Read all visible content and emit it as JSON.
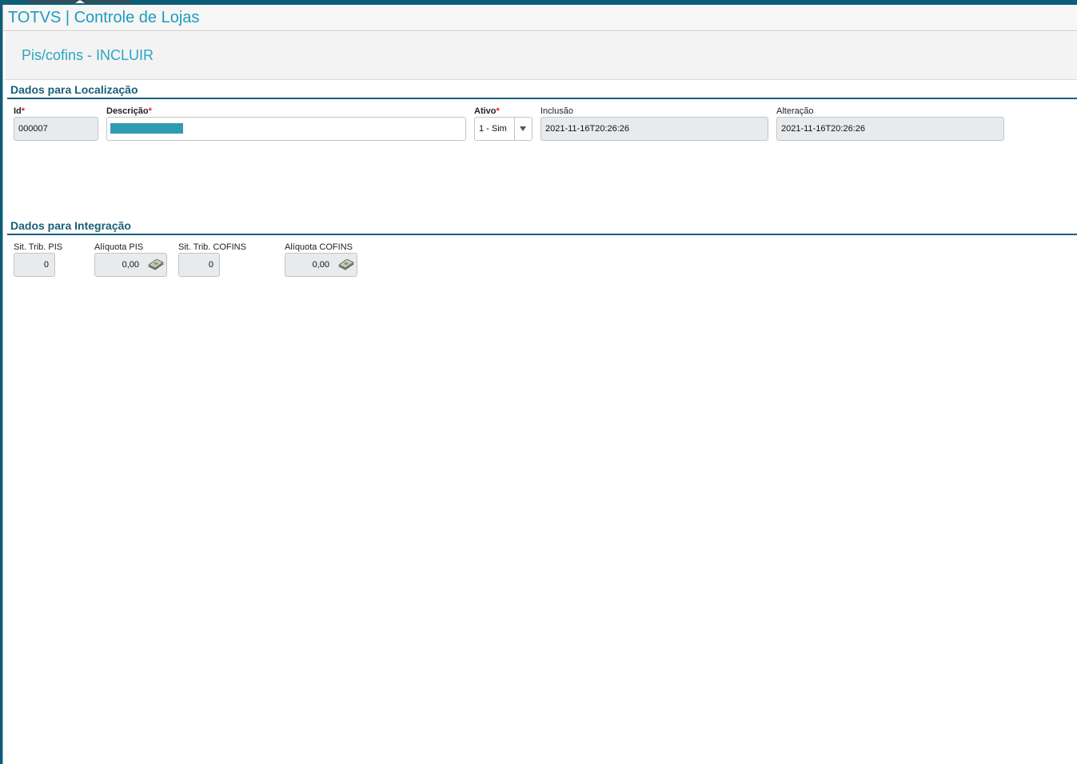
{
  "app": {
    "title": "TOTVS | Controle de Lojas"
  },
  "page": {
    "title": "Pis/cofins - INCLUIR"
  },
  "section_localizacao": {
    "title": "Dados para Localização",
    "id": {
      "label": "Id",
      "required_mark": "*",
      "value": "000007"
    },
    "descricao": {
      "label": "Descrição",
      "required_mark": "*",
      "value": "",
      "redacted": true
    },
    "ativo": {
      "label": "Ativo",
      "required_mark": "*",
      "value": "1 - Sim"
    },
    "inclusao": {
      "label": "Inclusão",
      "value": "2021-11-16T20:26:26"
    },
    "alteracao": {
      "label": "Alteração",
      "value": "2021-11-16T20:26:26"
    }
  },
  "section_integracao": {
    "title": "Dados para Integração",
    "sit_trib_pis": {
      "label": "Sit. Trib. PIS",
      "value": "0"
    },
    "aliquota_pis": {
      "label": "Alíquota PIS",
      "value": "0,00",
      "icon": "money-icon"
    },
    "sit_trib_cofins": {
      "label": "Sit. Trib. COFINS",
      "value": "0"
    },
    "aliquota_cofins": {
      "label": "Alíquota COFINS",
      "value": "0,00",
      "icon": "money-icon"
    }
  },
  "colors": {
    "accent": "#1d9bc0",
    "section": "#1a5f7a",
    "required": "#e02020"
  }
}
